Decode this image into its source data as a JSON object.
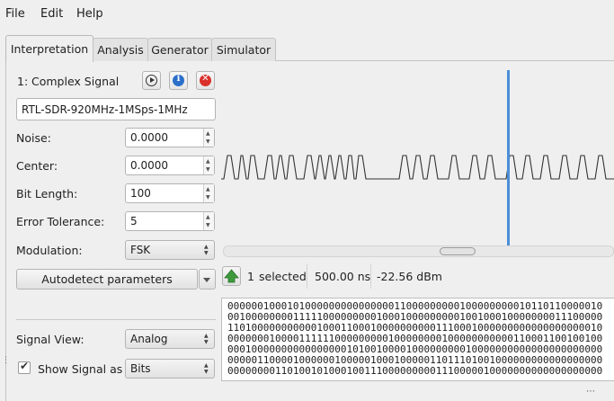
{
  "menu": {
    "file": "File",
    "edit": "Edit",
    "help": "Help"
  },
  "tabs": [
    "Interpretation",
    "Analysis",
    "Generator",
    "Simulator"
  ],
  "signal": {
    "index": "1:",
    "type": "Complex Signal",
    "name": "RTL-SDR-920MHz-1MSps-1MHz"
  },
  "params": {
    "noise_label": "Noise:",
    "noise_value": "0.0000",
    "center_label": "Center:",
    "center_value": "0.0000",
    "bitlength_label": "Bit Length:",
    "bitlength_value": "100",
    "tolerance_label": "Error Tolerance:",
    "tolerance_value": "5",
    "modulation_label": "Modulation:",
    "modulation_value": "FSK",
    "autodetect_label": "Autodetect parameters",
    "signal_view_label": "Signal View:",
    "signal_view_value": "Analog",
    "show_signal_label": "Show Signal as",
    "show_signal_value": "Bits"
  },
  "status": {
    "selected_count": "1",
    "selected_label": "selected",
    "duration": "500.00 ns",
    "power": "-22.56 dBm"
  },
  "bits": [
    "000000100010100000000000000011000000000100000000010110110000010",
    "001000000001111100000000010001000000000100100010000000011100000",
    "110100000000000100011000100000000001110001000000000000000000010",
    "000000010000111111000000000100000000100000000000110001100100100",
    "000100000000000000001010010000100000000010000000000000000000000",
    "000001100001000000100000100010000011011101001000000000000000000",
    "000000001101001010001001110000000001110000010000000000000000000"
  ],
  "colors": {
    "selection_marker": "#4a8fd8",
    "close_button": "#d9322b",
    "info_button": "#2b6fc9",
    "play_button_arrow": "#333333",
    "green_arrow": "#3c9a3c"
  }
}
